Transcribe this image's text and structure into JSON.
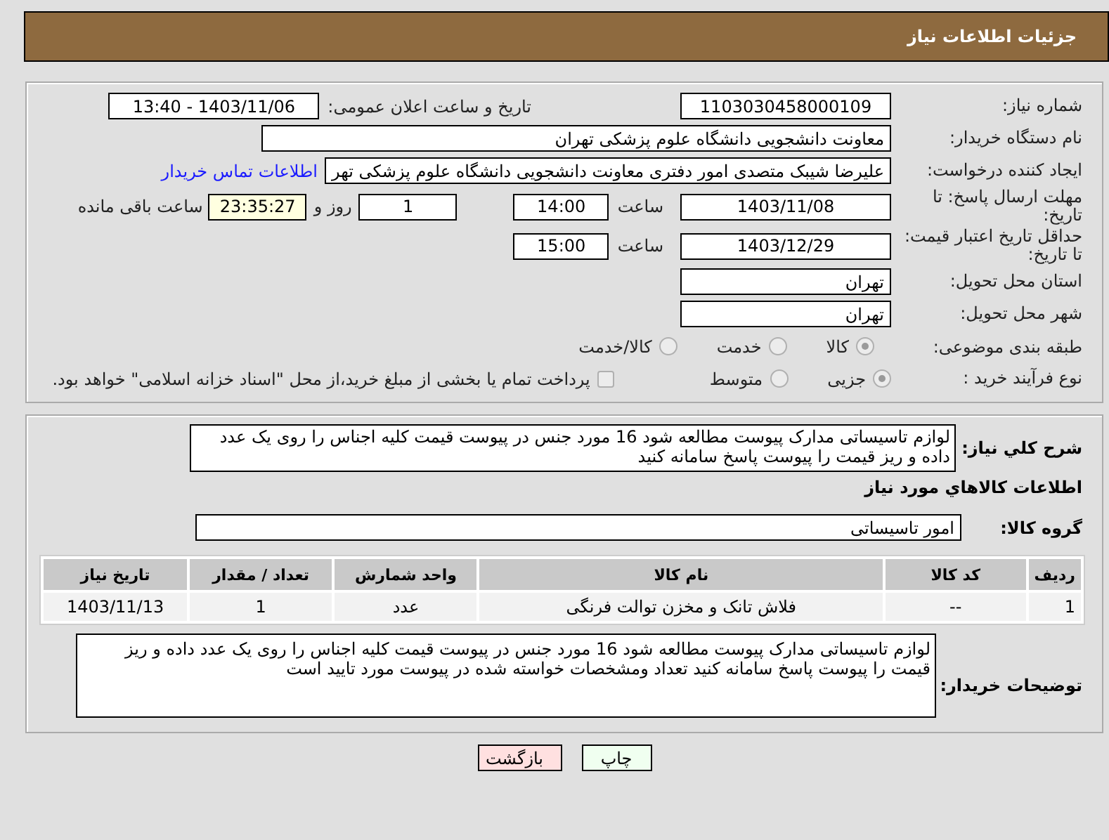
{
  "header": {
    "title": "جزئیات اطلاعات نیاز"
  },
  "need_info": {
    "need_number": {
      "label": "شماره نیاز:",
      "value": "1103030458000109"
    },
    "announce_datetime": {
      "label": "تاریخ و ساعت اعلان عمومی:",
      "value": "1403/11/06 - 13:40"
    },
    "buyer_org": {
      "label": "نام دستگاه خریدار:",
      "value": "معاونت دانشجویی دانشگاه علوم پزشکی تهران"
    },
    "requester": {
      "label": "ایجاد کننده درخواست:",
      "value": "علیرضا شیبک متصدی امور دفتری معاونت دانشجویی دانشگاه علوم پزشکی تهر",
      "link": "اطلاعات تماس خریدار"
    },
    "reply_deadline": {
      "label": "مهلت ارسال پاسخ: تا تاریخ:",
      "date": "1403/11/08",
      "time_label": "ساعت",
      "time": "14:00",
      "days": "1",
      "days_label": "روز و",
      "remaining": "23:35:27",
      "remaining_label": "ساعت باقی مانده"
    },
    "price_validity": {
      "label": "حداقل تاریخ اعتبار قیمت: تا تاریخ:",
      "date": "1403/12/29",
      "time_label": "ساعت",
      "time": "15:00"
    },
    "province": {
      "label": "استان محل تحویل:",
      "value": "تهران"
    },
    "city": {
      "label": "شهر محل تحویل:",
      "value": "تهران"
    },
    "category": {
      "label": "طبقه بندی موضوعی:",
      "options": [
        {
          "label": "کالا",
          "selected": true
        },
        {
          "label": "خدمت",
          "selected": false
        },
        {
          "label": "کالا/خدمت",
          "selected": false
        }
      ]
    },
    "purchase_type": {
      "label": "نوع فرآیند خرید :",
      "options": [
        {
          "label": "جزیی",
          "selected": true
        },
        {
          "label": "متوسط",
          "selected": false
        }
      ],
      "treasury": {
        "checked": false,
        "text": "پرداخت تمام یا بخشی از مبلغ خرید،از محل \"اسناد خزانه اسلامی\" خواهد بود."
      }
    }
  },
  "goods": {
    "description": {
      "label": "شرح کلي نیاز:",
      "value": "لوازم تاسیساتی مدارک پیوست مطالعه شود 16 مورد  جنس  در پیوست  قیمت کلیه اجناس را روی یک عدد داده و ریز قیمت را پیوست پاسخ سامانه کنید"
    },
    "section_title": "اطلاعات کالاهاي مورد نیاز",
    "group": {
      "label": "گروه کالا:",
      "value": "امور تاسیساتی"
    },
    "table": {
      "columns": [
        "ردیف",
        "کد کالا",
        "نام کالا",
        "واحد شمارش",
        "تعداد / مقدار",
        "تاریخ نیاز"
      ],
      "rows": [
        [
          "1",
          "--",
          "فلاش تانک و مخزن توالت فرنگی",
          "عدد",
          "1",
          "1403/11/13"
        ]
      ]
    },
    "buyer_notes": {
      "label": "توضیحات خریدار:",
      "value": "لوازم تاسیساتی مدارک پیوست مطالعه شود 16 مورد  جنس  در پیوست  قیمت کلیه اجناس را روی یک عدد داده و ریز قیمت را پیوست پاسخ سامانه کنید تعداد ومشخصات خواسته شده در پیوست مورد تایید است"
    }
  },
  "buttons": [
    {
      "kind": "print",
      "label": "چاپ"
    },
    {
      "kind": "back",
      "label": "بازگشت"
    }
  ]
}
